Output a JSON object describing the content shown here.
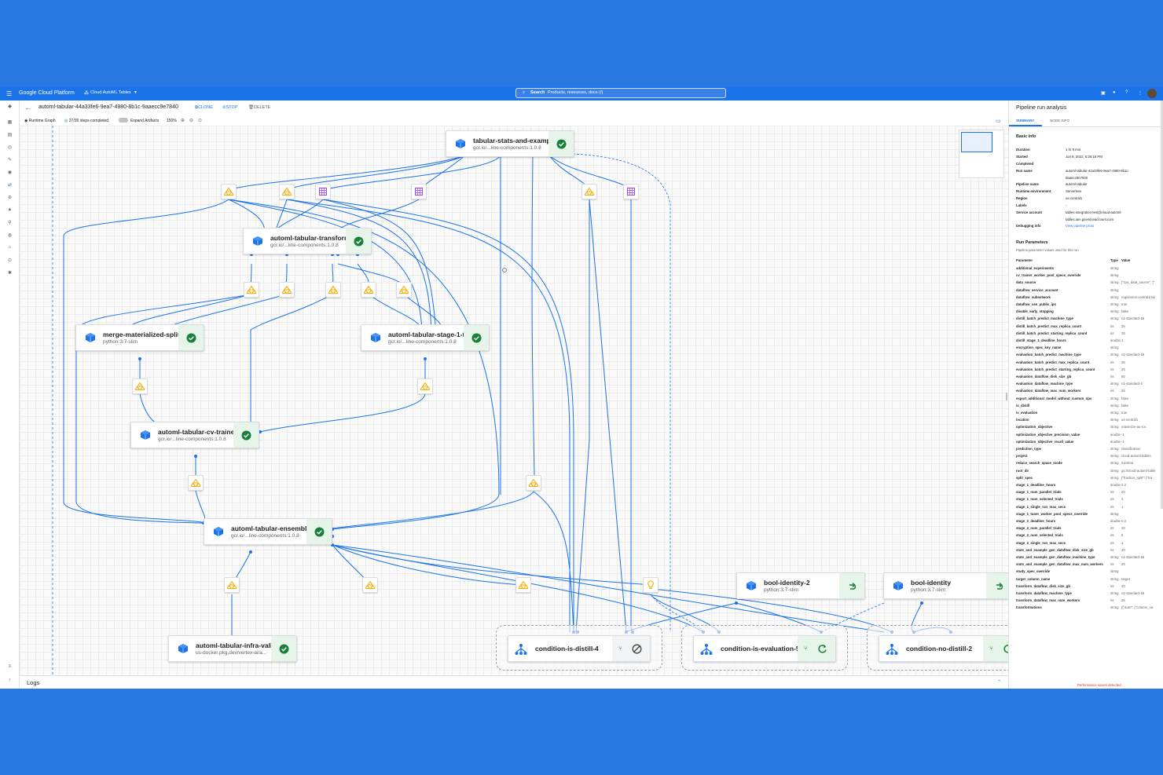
{
  "topbar": {
    "product": "Google Cloud Platform",
    "project": "Cloud AutoML Tables",
    "search_label": "Search",
    "search_placeholder": "Products, resources, docs (/)"
  },
  "header": {
    "run_name": "automl-tabular-44a33fe6-9ea7-4980-8b1c-9aaecc9e7840",
    "clone": "CLONE",
    "stop": "STOP",
    "delete": "DELETE",
    "runtime_graph": "Runtime Graph",
    "steps": "27/35 steps completed",
    "expand": "Expand Artifacts",
    "zoom": "150%"
  },
  "nodes": {
    "stats": {
      "title": "tabular-stats-and-exampl...",
      "sub": "gcr.io/...line-components:1.0.8"
    },
    "transform": {
      "title": "automl-tabular-transform",
      "sub": "gcr.io/...line-components:1.0.8"
    },
    "merge": {
      "title": "merge-materialized-splits",
      "sub": "python:3.7-slim"
    },
    "stage1": {
      "title": "automl-tabular-stage-1-t...",
      "sub": "gcr.io/...line-components:1.0.8"
    },
    "cv": {
      "title": "automl-tabular-cv-trainer",
      "sub": "gcr.io/...line-components:1.0.8"
    },
    "ensemble": {
      "title": "automl-tabular-ensemble",
      "sub": "gcr.io/...line-components:1.0.8"
    },
    "infra": {
      "title": "automl-tabular-infra-vali...",
      "sub": "us-docker.pkg.dev/vertex-ai/a..."
    },
    "bool2": {
      "title": "bool-identity-2",
      "sub": "python:3.7-slim"
    },
    "bool": {
      "title": "bool-identity",
      "sub": "python:3.7-slim"
    }
  },
  "conditions": {
    "c1": "condition-is-distill-4",
    "c2": "condition-is-evaluation-5",
    "c3": "condition-no-distill-2"
  },
  "logs": "Logs",
  "panel": {
    "title": "Pipeline run analysis",
    "tab_summary": "SUMMARY",
    "tab_node": "NODE INFO",
    "basic_info": "Basic info",
    "info": [
      {
        "k": "Duration",
        "v": "1 hr 9 min"
      },
      {
        "k": "Started",
        "v": "Jun 8, 2022, 5:26:18 PM"
      },
      {
        "k": "Completed",
        "v": ""
      },
      {
        "k": "Run name",
        "v": "automl-tabular-44a33fe6-9ea7-4980-8b1c-"
      },
      {
        "k": "",
        "v": "9aaecc9e7840"
      },
      {
        "k": "Pipeline name",
        "v": "automl-tabular"
      },
      {
        "k": "Runtime environment",
        "v": "Serverless"
      },
      {
        "k": "Region",
        "v": "us-central1"
      },
      {
        "k": "Labels",
        "v": "-"
      },
      {
        "k": "Service account",
        "v": "tables-integration-test@cloud-automl-"
      },
      {
        "k": "",
        "v": "tables.iam.gserviceaccount.com"
      },
      {
        "k": "Debugging info",
        "v": "View pipeline proto"
      }
    ],
    "run_params": "Run Parameters",
    "run_params_desc": "Pipeline parameter values used for this run",
    "param_header": {
      "p": "Parameter",
      "t": "Type",
      "v": "Value"
    },
    "params": [
      [
        "additional_experiments",
        "string",
        ""
      ],
      [
        "cv_trainer_worker_pool_specs_override",
        "string",
        ""
      ],
      [
        "data_source",
        "string",
        "{\"csv_data_source\": {\""
      ],
      [
        "dataflow_service_account",
        "string",
        ""
      ],
      [
        "dataflow_subnetwork",
        "string",
        "regions/us-central1/sul"
      ],
      [
        "dataflow_use_public_ips",
        "string",
        "true"
      ],
      [
        "disable_early_stopping",
        "string",
        "false"
      ],
      [
        "distill_batch_predict_machine_type",
        "string",
        "n1-standard-16"
      ],
      [
        "distill_batch_predict_max_replica_count",
        "int",
        "25"
      ],
      [
        "distill_batch_predict_starting_replica_count",
        "int",
        "25"
      ],
      [
        "distill_stage_1_deadline_hours",
        "double",
        "1"
      ],
      [
        "encryption_spec_key_name",
        "string",
        ""
      ],
      [
        "evaluation_batch_predict_machine_type",
        "string",
        "n1-standard-16"
      ],
      [
        "evaluation_batch_predict_max_replica_count",
        "int",
        "25"
      ],
      [
        "evaluation_batch_predict_starting_replica_count",
        "int",
        "25"
      ],
      [
        "evaluation_dataflow_disk_size_gb",
        "int",
        "50"
      ],
      [
        "evaluation_dataflow_machine_type",
        "string",
        "n1-standard-4"
      ],
      [
        "evaluation_dataflow_max_num_workers",
        "int",
        "25"
      ],
      [
        "export_additional_model_without_custom_ops",
        "string",
        "false"
      ],
      [
        "is_distill",
        "string",
        "false"
      ],
      [
        "is_evaluation",
        "string",
        "true"
      ],
      [
        "location",
        "string",
        "us-central1"
      ],
      [
        "optimization_objective",
        "string",
        "maximize-au-roc"
      ],
      [
        "optimization_objective_precision_value",
        "double",
        "-1"
      ],
      [
        "optimization_objective_recall_value",
        "double",
        "-1"
      ],
      [
        "prediction_type",
        "string",
        "classification"
      ],
      [
        "project",
        "string",
        "cloud-automl-tables"
      ],
      [
        "reduce_search_space_mode",
        "string",
        "minimal"
      ],
      [
        "root_dir",
        "string",
        "gs://cloud-automl-table"
      ],
      [
        "split_spec",
        "string",
        "{\"fraction_split\": {\"tra"
      ],
      [
        "stage_1_deadline_hours",
        "double",
        "0.2"
      ],
      [
        "stage_1_num_parallel_trials",
        "int",
        "20"
      ],
      [
        "stage_1_num_selected_trials",
        "int",
        "4"
      ],
      [
        "stage_1_single_run_max_secs",
        "int",
        "1"
      ],
      [
        "stage_1_tuner_worker_pool_specs_override",
        "string",
        ""
      ],
      [
        "stage_2_deadline_hours",
        "double",
        "0.2"
      ],
      [
        "stage_2_num_parallel_trials",
        "int",
        "20"
      ],
      [
        "stage_2_num_selected_trials",
        "int",
        "5"
      ],
      [
        "stage_2_single_run_max_secs",
        "int",
        "1"
      ],
      [
        "stats_and_example_gen_dataflow_disk_size_gb",
        "int",
        "40"
      ],
      [
        "stats_and_example_gen_dataflow_machine_type",
        "string",
        "n1-standard-16"
      ],
      [
        "stats_and_example_gen_dataflow_max_num_workers",
        "int",
        "25"
      ],
      [
        "study_spec_override",
        "string",
        ""
      ],
      [
        "target_column_name",
        "string",
        "target"
      ],
      [
        "transform_dataflow_disk_size_gb",
        "int",
        "40"
      ],
      [
        "transform_dataflow_machine_type",
        "string",
        "n1-standard-16"
      ],
      [
        "transform_dataflow_max_num_workers",
        "int",
        "25"
      ],
      [
        "transformations",
        "string",
        "[{\"auto\": {\"column_na"
      ]
    ],
    "perf": "Performance issues detected"
  },
  "colors": {
    "accent": "#1a73e8",
    "success": "#188038",
    "artifact": "#fbbc04",
    "dataset": "#a142f4",
    "background": "#2a79e2"
  }
}
